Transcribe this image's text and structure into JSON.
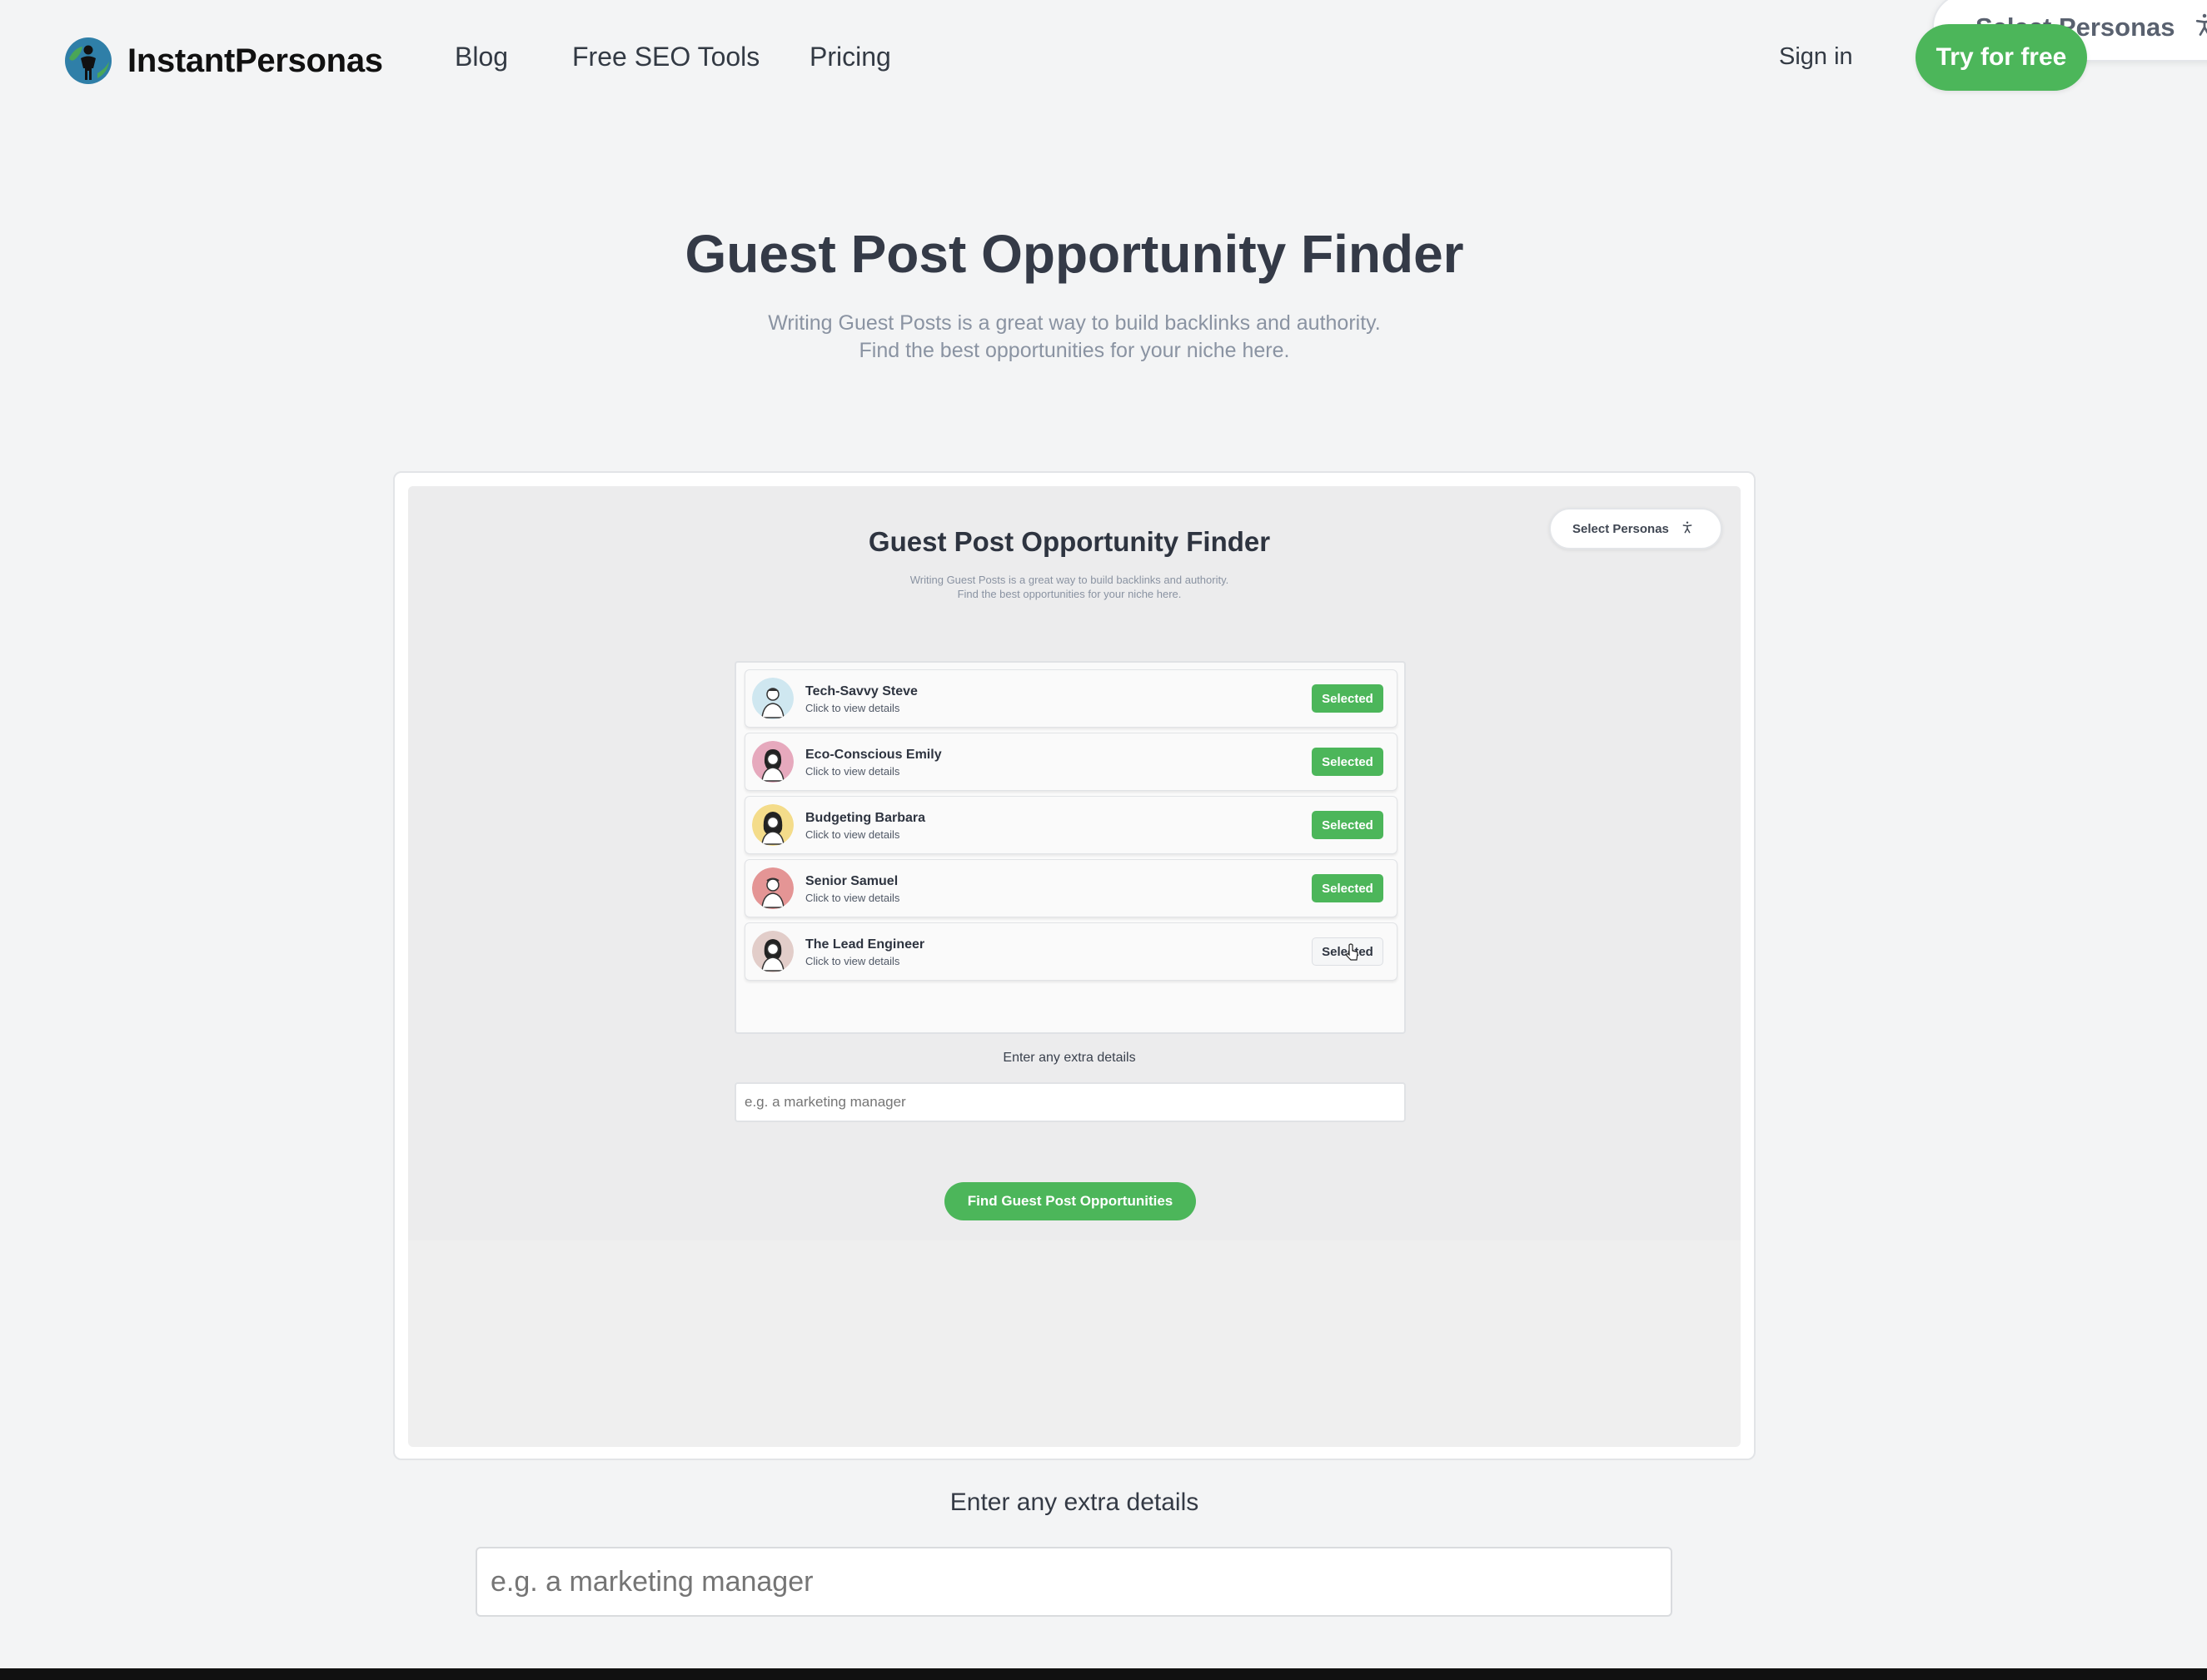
{
  "header": {
    "brand_name": "InstantPersonas",
    "nav": [
      {
        "label": "Blog"
      },
      {
        "label": "Free SEO Tools"
      },
      {
        "label": "Pricing"
      }
    ],
    "signin_label": "Sign in",
    "try_label": "Try for free",
    "select_personas_label": "Select Personas"
  },
  "hero": {
    "title": "Guest Post Opportunity Finder",
    "subtitle_line1": "Writing Guest Posts is a great way to build backlinks and authority.",
    "subtitle_line2": "Find the best opportunities for your niche here."
  },
  "preview": {
    "select_personas_label": "Select Personas",
    "title": "Guest Post Opportunity Finder",
    "subtitle_line1": "Writing Guest Posts is a great way to build backlinks and authority.",
    "subtitle_line2": "Find the best opportunities for your niche here.",
    "personas": [
      {
        "name": "Tech-Savvy Steve",
        "sub": "Click to view details",
        "status": "Selected",
        "avatar_color": "#cfe7f0"
      },
      {
        "name": "Eco-Conscious Emily",
        "sub": "Click to view details",
        "status": "Selected",
        "avatar_color": "#e6a9bd"
      },
      {
        "name": "Budgeting Barbara",
        "sub": "Click to view details",
        "status": "Selected",
        "avatar_color": "#f4dc8a"
      },
      {
        "name": "Senior Samuel",
        "sub": "Click to view details",
        "status": "Selected",
        "avatar_color": "#e49595"
      },
      {
        "name": "The Lead Engineer",
        "sub": "Click to view details",
        "status": "Selected",
        "avatar_color": "#e2cdc9"
      }
    ],
    "extra_label": "Enter any extra details",
    "extra_placeholder": "e.g. a marketing manager",
    "find_button": "Find Guest Post Opportunities"
  },
  "bottom": {
    "extra_label": "Enter any extra details",
    "extra_placeholder": "e.g. a marketing manager"
  },
  "colors": {
    "accent_green": "#4cb65a",
    "background": "#f3f4f5",
    "heading": "#343a47"
  }
}
